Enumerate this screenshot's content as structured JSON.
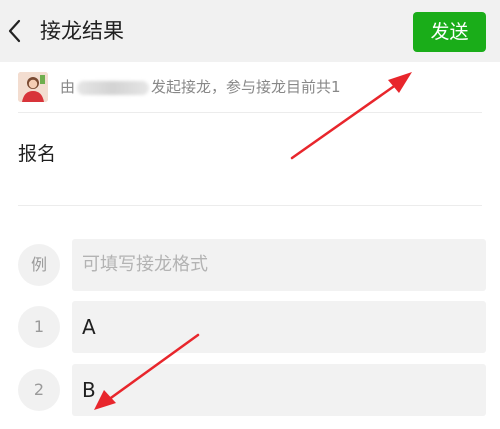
{
  "header": {
    "title": "接龙结果",
    "send_label": "发送"
  },
  "initiator": {
    "prefix": "由",
    "suffix": "发起接龙，参与接龙目前共1"
  },
  "signup_title": "报名",
  "example": {
    "marker": "例",
    "placeholder": "可填写接龙格式"
  },
  "entries": [
    {
      "number": "1",
      "text": "A"
    },
    {
      "number": "2",
      "text": "B"
    }
  ],
  "colors": {
    "accent": "#1aad19",
    "annotation_arrow": "#e8262c"
  }
}
